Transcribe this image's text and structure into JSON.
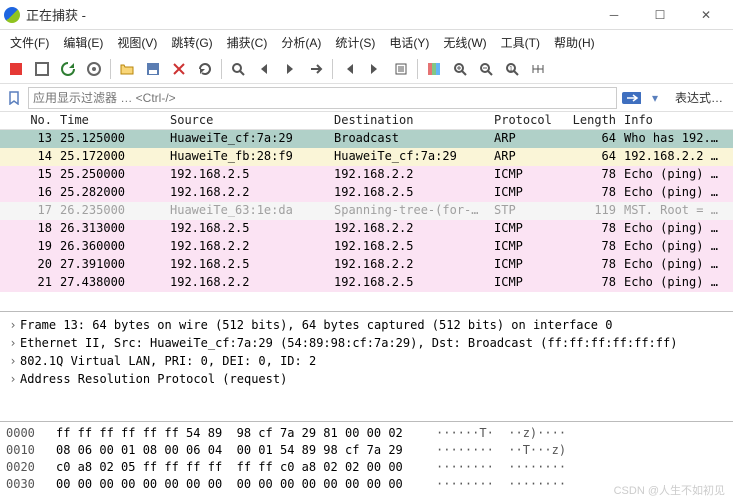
{
  "window": {
    "title": "正在捕获 -"
  },
  "menu": [
    "文件(F)",
    "编辑(E)",
    "视图(V)",
    "跳转(G)",
    "捕获(C)",
    "分析(A)",
    "统计(S)",
    "电话(Y)",
    "无线(W)",
    "工具(T)",
    "帮助(H)"
  ],
  "filter": {
    "placeholder": "应用显示过滤器 … <Ctrl-/>",
    "expr": "表达式…"
  },
  "cols": {
    "no": "No.",
    "time": "Time",
    "src": "Source",
    "dst": "Destination",
    "proto": "Protocol",
    "len": "Length",
    "info": "Info"
  },
  "rows": [
    {
      "no": "13",
      "time": "25.125000",
      "src": "HuaweiTe_cf:7a:29",
      "dst": "Broadcast",
      "proto": "ARP",
      "len": "64",
      "info": "Who has 192.…",
      "cls": "r-sel"
    },
    {
      "no": "14",
      "time": "25.172000",
      "src": "HuaweiTe_fb:28:f9",
      "dst": "HuaweiTe_cf:7a:29",
      "proto": "ARP",
      "len": "64",
      "info": "192.168.2.2 …",
      "cls": "r-arp"
    },
    {
      "no": "15",
      "time": "25.250000",
      "src": "192.168.2.5",
      "dst": "192.168.2.2",
      "proto": "ICMP",
      "len": "78",
      "info": "Echo (ping) …",
      "cls": "r-icmp"
    },
    {
      "no": "16",
      "time": "25.282000",
      "src": "192.168.2.2",
      "dst": "192.168.2.5",
      "proto": "ICMP",
      "len": "78",
      "info": "Echo (ping) …",
      "cls": "r-icmp"
    },
    {
      "no": "17",
      "time": "26.235000",
      "src": "HuaweiTe_63:1e:da",
      "dst": "Spanning-tree-(for-…",
      "proto": "STP",
      "len": "119",
      "info": "MST. Root = …",
      "cls": "r-stp"
    },
    {
      "no": "18",
      "time": "26.313000",
      "src": "192.168.2.5",
      "dst": "192.168.2.2",
      "proto": "ICMP",
      "len": "78",
      "info": "Echo (ping) …",
      "cls": "r-icmp"
    },
    {
      "no": "19",
      "time": "26.360000",
      "src": "192.168.2.2",
      "dst": "192.168.2.5",
      "proto": "ICMP",
      "len": "78",
      "info": "Echo (ping) …",
      "cls": "r-icmp"
    },
    {
      "no": "20",
      "time": "27.391000",
      "src": "192.168.2.5",
      "dst": "192.168.2.2",
      "proto": "ICMP",
      "len": "78",
      "info": "Echo (ping) …",
      "cls": "r-icmp"
    },
    {
      "no": "21",
      "time": "27.438000",
      "src": "192.168.2.2",
      "dst": "192.168.2.5",
      "proto": "ICMP",
      "len": "78",
      "info": "Echo (ping) …",
      "cls": "r-icmp"
    }
  ],
  "detail": [
    "Frame 13: 64 bytes on wire (512 bits), 64 bytes captured (512 bits) on interface 0",
    "Ethernet II, Src: HuaweiTe_cf:7a:29 (54:89:98:cf:7a:29), Dst: Broadcast (ff:ff:ff:ff:ff:ff)",
    "802.1Q Virtual LAN, PRI: 0, DEI: 0, ID: 2",
    "Address Resolution Protocol (request)"
  ],
  "hex": [
    {
      "off": "0000",
      "b": "ff ff ff ff ff ff 54 89  98 cf 7a 29 81 00 00 02",
      "a": "······T·  ··z)····"
    },
    {
      "off": "0010",
      "b": "08 06 00 01 08 00 06 04  00 01 54 89 98 cf 7a 29",
      "a": "········  ··T···z)"
    },
    {
      "off": "0020",
      "b": "c0 a8 02 05 ff ff ff ff  ff ff c0 a8 02 02 00 00",
      "a": "········  ········"
    },
    {
      "off": "0030",
      "b": "00 00 00 00 00 00 00 00  00 00 00 00 00 00 00 00",
      "a": "········  ········"
    }
  ],
  "watermark": "CSDN @人生不如初见"
}
